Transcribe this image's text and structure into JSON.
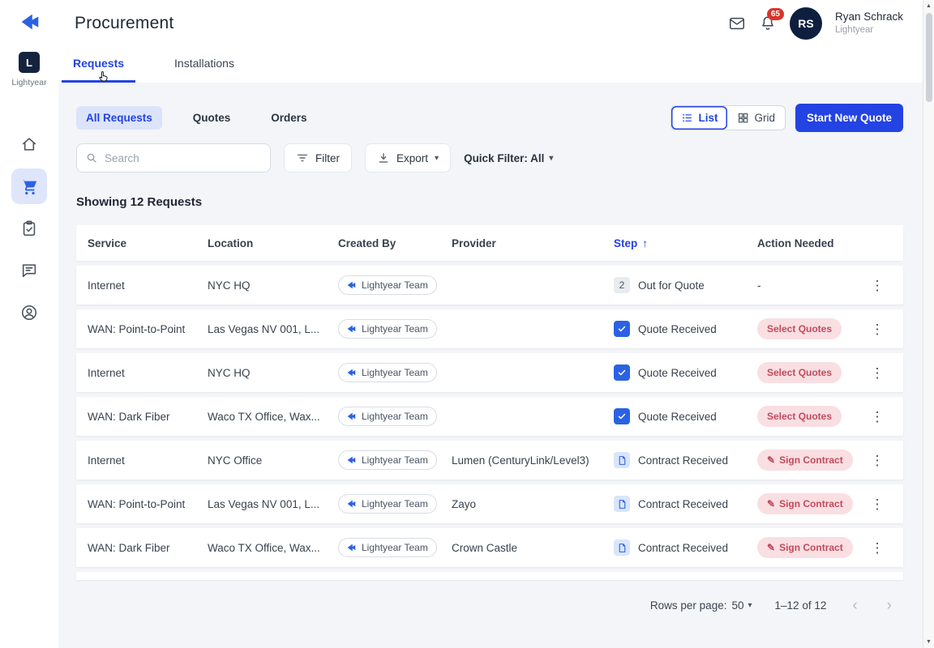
{
  "header": {
    "title": "Procurement",
    "notification_count": "65",
    "user": {
      "initials": "RS",
      "name": "Ryan Schrack",
      "org": "Lightyear"
    }
  },
  "sidebar": {
    "org_initial": "L",
    "org_label": "Lightyear"
  },
  "tabs": {
    "requests": "Requests",
    "installations": "Installations"
  },
  "subtabs": {
    "all": "All Requests",
    "quotes": "Quotes",
    "orders": "Orders"
  },
  "view_toggle": {
    "list": "List",
    "grid": "Grid"
  },
  "actions": {
    "start_new_quote": "Start New Quote"
  },
  "toolbar": {
    "search_placeholder": "Search",
    "filter": "Filter",
    "export": "Export",
    "quick_filter": "Quick Filter: All"
  },
  "summary": "Showing 12 Requests",
  "table": {
    "columns": [
      "Service",
      "Location",
      "Created By",
      "Provider",
      "Step",
      "Action Needed"
    ],
    "sorted_column": "Step",
    "sort_direction": "asc",
    "rows": [
      {
        "service": "Internet",
        "location": "NYC HQ",
        "created_by": "Lightyear Team",
        "provider": "",
        "step": "Out for Quote",
        "step_icon": "number",
        "step_badge": "2",
        "action": "-",
        "action_type": "text"
      },
      {
        "service": "WAN: Point-to-Point",
        "location": "Las Vegas NV 001, L...",
        "created_by": "Lightyear Team",
        "provider": "",
        "step": "Quote Received",
        "step_icon": "check",
        "action": "Select Quotes",
        "action_type": "pill"
      },
      {
        "service": "Internet",
        "location": "NYC HQ",
        "created_by": "Lightyear Team",
        "provider": "",
        "step": "Quote Received",
        "step_icon": "check",
        "action": "Select Quotes",
        "action_type": "pill"
      },
      {
        "service": "WAN: Dark Fiber",
        "location": "Waco TX Office, Wax...",
        "created_by": "Lightyear Team",
        "provider": "",
        "step": "Quote Received",
        "step_icon": "check",
        "action": "Select Quotes",
        "action_type": "pill"
      },
      {
        "service": "Internet",
        "location": "NYC Office",
        "created_by": "Lightyear Team",
        "provider": "Lumen (CenturyLink/Level3)",
        "step": "Contract Received",
        "step_icon": "doc",
        "action": "Sign Contract",
        "action_type": "pill-edit"
      },
      {
        "service": "WAN: Point-to-Point",
        "location": "Las Vegas NV 001, L...",
        "created_by": "Lightyear Team",
        "provider": "Zayo",
        "step": "Contract Received",
        "step_icon": "doc",
        "action": "Sign Contract",
        "action_type": "pill-edit"
      },
      {
        "service": "WAN: Dark Fiber",
        "location": "Waco TX Office, Wax...",
        "created_by": "Lightyear Team",
        "provider": "Crown Castle",
        "step": "Contract Received",
        "step_icon": "doc",
        "action": "Sign Contract",
        "action_type": "pill-edit"
      }
    ]
  },
  "pagination": {
    "rows_per_page_label": "Rows per page:",
    "rows_per_page_value": "50",
    "range": "1–12 of 12"
  },
  "colors": {
    "primary": "#2343e2",
    "accent-blue": "#2b62e3",
    "badge-red": "#d8352a",
    "pill-bg": "#f9dee2",
    "pill-text": "#c14b5e"
  }
}
